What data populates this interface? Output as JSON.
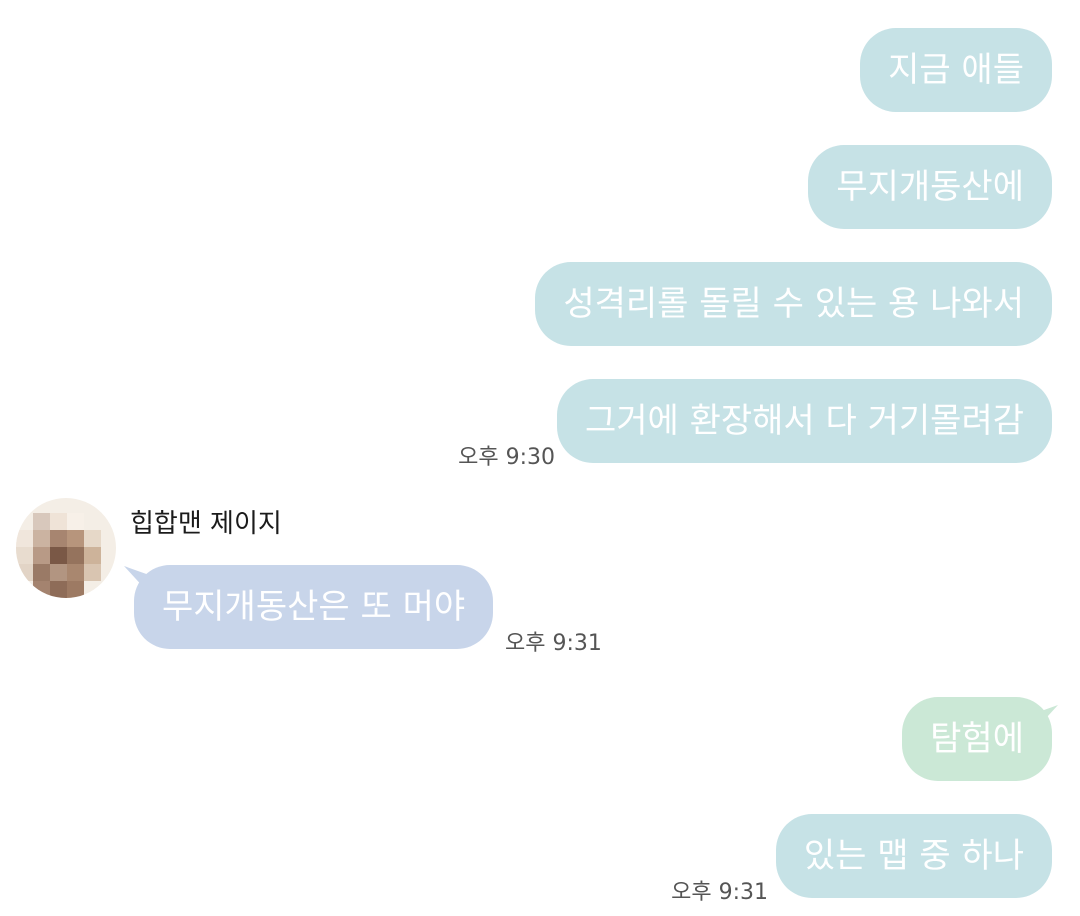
{
  "chat": {
    "outgoing_group_1": [
      "지금 애들",
      "무지개동산에",
      "성격리롤 돌릴 수 있는 용 나와서",
      "그거에 환장해서 다 거기몰려감"
    ],
    "time_1": "오후 9:30",
    "incoming": {
      "sender_name": "힙합맨 제이지",
      "message": "무지개동산은 또 머야",
      "time": "오후 9:31"
    },
    "outgoing_group_2": [
      "탐험에",
      "있는 맵 중 하나"
    ],
    "time_2": "오후 9:31"
  },
  "colors": {
    "outgoing_bubble": "#c6e2e6",
    "incoming_bubble": "#c8d5ea",
    "outgoing_green_bubble": "#cbe8d6",
    "bubble_text": "#ffffff",
    "timestamp": "#555555"
  },
  "icons": {
    "avatar": "avatar-icon"
  }
}
